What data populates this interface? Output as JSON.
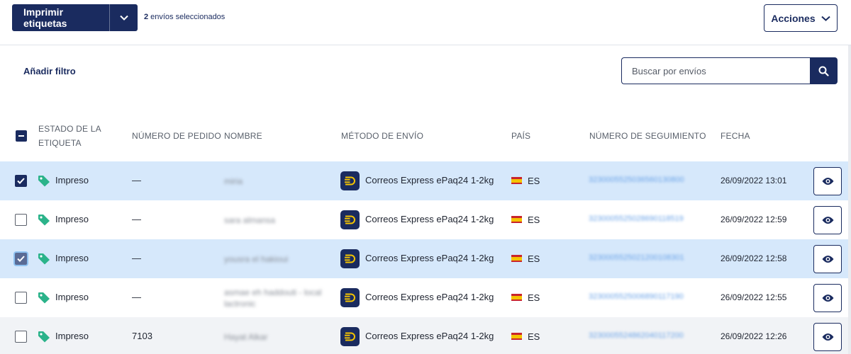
{
  "toolbar": {
    "print_label": "Imprimir etiquetas",
    "selected_count": "2",
    "selected_text": "envíos seleccionados",
    "actions_label": "Acciones"
  },
  "filters": {
    "add_filter_label": "Añadir filtro",
    "search_placeholder": "Buscar por envíos"
  },
  "table": {
    "columns": {
      "status_line1": "ESTADO DE LA",
      "status_line2": "ETIQUETA",
      "order": "NÚMERO DE PEDIDO",
      "name": "NOMBRE",
      "method": "MÉTODO DE ENVÍO",
      "country": "PAÍS",
      "tracking": "NÚMERO DE SEGUIMIENTO",
      "date": "FECHA"
    },
    "rows": [
      {
        "selected": true,
        "status": "Impreso",
        "order": "—",
        "name": "miria",
        "method": "Correos Express ePaq24 1-2kg",
        "country": "ES",
        "tracking": "3230005525036560130800",
        "date": "26/09/2022 13:01"
      },
      {
        "selected": false,
        "status": "Impreso",
        "order": "—",
        "name": "sara almansa",
        "method": "Correos Express ePaq24 1-2kg",
        "country": "ES",
        "tracking": "3230005525028690118519",
        "date": "26/09/2022 12:59"
      },
      {
        "selected": true,
        "status": "Impreso",
        "order": "—",
        "name": "yousra el hakioui",
        "method": "Correos Express ePaq24 1-2kg",
        "country": "ES",
        "tracking": "3230005525021200108301",
        "date": "26/09/2022 12:58"
      },
      {
        "selected": false,
        "status": "Impreso",
        "order": "—",
        "name": "asmae eh haddouti - local lactronic",
        "method": "Correos Express ePaq24 1-2kg",
        "country": "ES",
        "tracking": "3230005525006890117190",
        "date": "26/09/2022 12:55"
      },
      {
        "selected": false,
        "status": "Impreso",
        "order": "7103",
        "name": "Hayat Alkar",
        "method": "Correos Express ePaq24 1-2kg",
        "country": "ES",
        "tracking": "3230005524862040117200",
        "date": "26/09/2022 12:26"
      }
    ]
  },
  "colors": {
    "primary": "#1a2b5f",
    "selected_row": "#d6e8fb",
    "tag_green": "#2bb38a",
    "link_blue": "#6aa3e8"
  },
  "icons": {
    "print_dropdown": "chevron-down-icon",
    "actions_dropdown": "chevron-down-icon",
    "search": "search-icon",
    "status": "tag-icon",
    "carrier": "correos-express-logo-icon",
    "country": "spain-flag-icon",
    "view": "eye-icon"
  }
}
